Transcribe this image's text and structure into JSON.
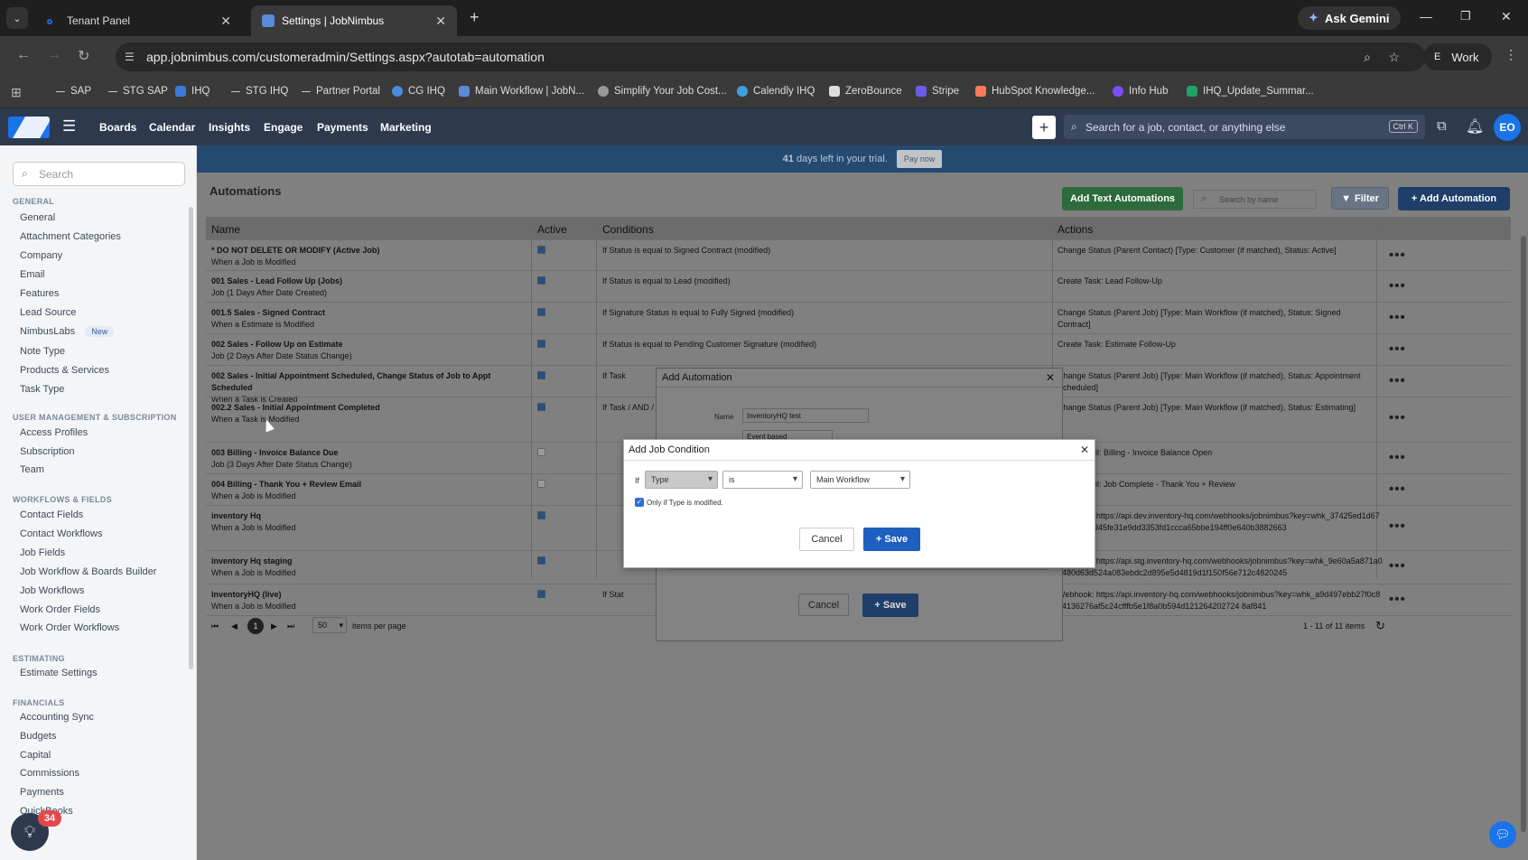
{
  "browser": {
    "tabs": [
      {
        "title": "Tenant Panel"
      },
      {
        "title": "Settings | JobNimbus"
      }
    ],
    "ask_gemini": "Ask Gemini",
    "url": "app.jobnimbus.com/customeradmin/Settings.aspx?autotab=automation",
    "profile": "Work",
    "profile_initial": "E",
    "bookmarks": [
      "SAP",
      "STG SAP",
      "IHQ",
      "STG IHQ",
      "Partner Portal",
      "CG IHQ",
      "Main Workflow | JobN...",
      "Simplify Your Job Cost...",
      "Calendly IHQ",
      "ZeroBounce",
      "Stripe",
      "HubSpot Knowledge...",
      "Info Hub",
      "IHQ_Update_Summar..."
    ]
  },
  "app": {
    "nav": [
      "Boards",
      "Calendar",
      "Insights",
      "Engage",
      "Payments",
      "Marketing"
    ],
    "search_placeholder": "Search for a job, contact, or anything else",
    "shortcut": "Ctrl K",
    "avatar": "EO"
  },
  "sidebar": {
    "search_placeholder": "Search",
    "sections": [
      {
        "title": "GENERAL",
        "items": [
          "General",
          "Attachment Categories",
          "Company",
          "Email",
          "Features",
          "Lead Source",
          "NimbusLabs",
          "Note Type",
          "Products & Services",
          "Task Type"
        ]
      },
      {
        "title": "USER MANAGEMENT & SUBSCRIPTION",
        "items": [
          "Access Profiles",
          "Subscription",
          "Team"
        ]
      },
      {
        "title": "WORKFLOWS & FIELDS",
        "items": [
          "Contact Fields",
          "Contact Workflows",
          "Job Fields",
          "Job Workflow & Boards Builder",
          "Job Workflows",
          "Work Order Fields",
          "Work Order Workflows"
        ]
      },
      {
        "title": "ESTIMATING",
        "items": [
          "Estimate Settings"
        ]
      },
      {
        "title": "FINANCIALS",
        "items": [
          "Accounting Sync",
          "Budgets",
          "Capital",
          "Commissions",
          "Payments",
          "QuickBooks"
        ]
      }
    ],
    "new_badge": "New",
    "help_count": "34"
  },
  "trial": {
    "days": "41",
    "text": "days left in your trial.",
    "pay_now": "Pay now"
  },
  "automations": {
    "title": "Automations",
    "add_text": "Add Text Automations",
    "search_placeholder": "Search by name",
    "filter": "Filter",
    "add": "+ Add Automation",
    "columns": [
      "Name",
      "Active",
      "Conditions",
      "Actions"
    ],
    "rows": [
      {
        "name": "* DO NOT DELETE OR MODIFY (Active Job)",
        "trigger": "When a Job is Modified",
        "active": true,
        "condition": "If Status is equal to Signed Contract (modified)",
        "action": "Change Status (Parent Contact) [Type: Customer (if matched), Status: Active]"
      },
      {
        "name": "001 Sales - Lead Follow Up (Jobs)",
        "trigger": "Job (1 Days After Date Created)",
        "active": true,
        "condition": "If Status is equal to Lead (modified)",
        "action": "Create Task: Lead Follow-Up"
      },
      {
        "name": "001.5 Sales - Signed Contract",
        "trigger": "When a Estimate is Modified",
        "active": true,
        "condition": "If Signature Status is equal to Fully Signed (modified)",
        "action": "Change Status (Parent Job) [Type: Main Workflow (if matched), Status: Signed Contract]"
      },
      {
        "name": "002 Sales - Follow Up on Estimate",
        "trigger": "Job (2 Days After Date Status Change)",
        "active": true,
        "condition": "If Status is equal to Pending Customer Signature (modified)",
        "action": "Create Task: Estimate Follow-Up"
      },
      {
        "name": "002 Sales - Initial Appointment Scheduled, Change Status of Job to Appt Scheduled",
        "trigger": "When a Task is Created",
        "active": true,
        "condition": "If Task",
        "action": "Change Status (Parent Job) [Type: Main Workflow (if matched), Status: Appointment Scheduled]"
      },
      {
        "name": "002.2 Sales - Initial Appointment Completed",
        "trigger": "When a Task is Modified",
        "active": true,
        "condition": "If Task / AND / If Is C",
        "action": "Change Status (Parent Job) [Type: Main Workflow (if matched), Status: Estimating]"
      },
      {
        "name": "003 Billing - Invoice Balance Due",
        "trigger": "Job (3 Days After Date Status Change)",
        "active": false,
        "condition": "",
        "action": "Send Email: Billing - Invoice Balance Open"
      },
      {
        "name": "004 Billing - Thank You + Review Email",
        "trigger": "When a Job is Modified",
        "active": false,
        "condition": "",
        "action": "Send Email: Job Complete - Thank You + Review"
      },
      {
        "name": "inventory Hq",
        "trigger": "When a Job is Modified",
        "active": true,
        "condition": "",
        "action": "Webhook: https://api.dev.inventory-hq.com/webhooks/jobnimbus?key=whk_37425ed1d67985e988e945fe31e9dd3353fd1ccca65bbe194ff0e640b3882663"
      },
      {
        "name": "inventory Hq staging",
        "trigger": "When a Job is Modified",
        "active": true,
        "condition": "",
        "action": "Webhook: https://api.stg.inventory-hq.com/webhooks/jobnimbus?key=whk_9e60a5a871a0d480d63d524a083ebdc2d895e5d4819d1f150f56e712c4820245"
      },
      {
        "name": "InventoryHQ (live)",
        "trigger": "When a Job is Modified",
        "active": true,
        "condition": "If Stat",
        "action": "Webhook: https://api.inventory-hq.com/webhooks/jobnimbus?key=whk_a9d497ebb27f0c824136276af5c24cfffb5e1f8a0b594d121264202724 8af841"
      }
    ],
    "pager": {
      "page": "1",
      "per_page": "50",
      "per_page_label": "items per page",
      "range": "1 - 11 of 11 items"
    }
  },
  "add_automation_modal": {
    "title": "Add Automation",
    "name_label": "Name",
    "name_value": "InventoryHQ test",
    "trigger_value": "Event based",
    "cancel": "Cancel",
    "save": "+ Save"
  },
  "add_condition_modal": {
    "title": "Add Job Condition",
    "if_label": "If",
    "field": "Type",
    "operator": "is",
    "value": "Main Workflow",
    "only_if_label": "Only if Type is modified.",
    "cancel": "Cancel",
    "save": "+ Save"
  }
}
